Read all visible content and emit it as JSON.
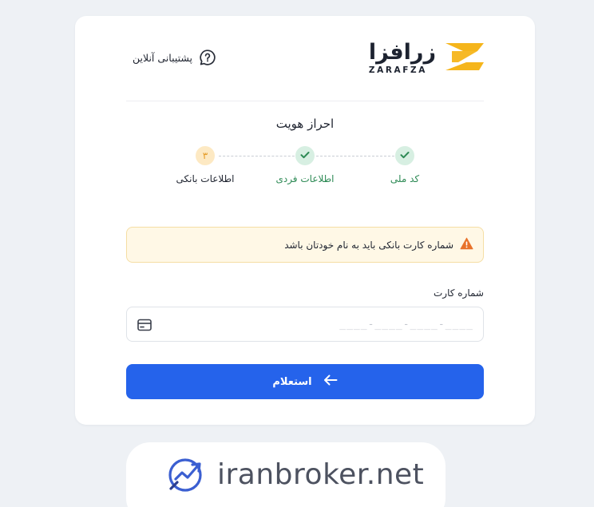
{
  "header": {
    "support_label": "پشتیبانی آنلاین",
    "support_icon": "help-chat-icon",
    "logo_fa": "زرافزا",
    "logo_en": "ZARAFZA"
  },
  "title": "احراز هویت",
  "steps": [
    {
      "label": "کد ملی",
      "state": "done",
      "icon": "check-icon"
    },
    {
      "label": "اطلاعات فردی",
      "state": "done",
      "icon": "check-icon"
    },
    {
      "label": "اطلاعات بانکی",
      "state": "current",
      "number": "۳"
    }
  ],
  "alert": {
    "text": "شماره کارت بانکی باید به نام خودتان باشد",
    "icon": "warning-icon"
  },
  "card_field": {
    "label": "شماره کارت",
    "placeholder": "____-____-____-____",
    "value": "",
    "icon": "wallet-icon"
  },
  "submit": {
    "label": "استعلام",
    "icon": "arrow-left-icon"
  },
  "watermark": {
    "text": "iranbroker.net"
  },
  "colors": {
    "primary": "#2563eb",
    "success": "#2d8a55",
    "success_bg": "#d7efe2",
    "warning": "#e8722a",
    "warning_bg": "#fff8e6",
    "brand_yellow": "#f5b51b",
    "page_bg": "#eef1f5"
  }
}
